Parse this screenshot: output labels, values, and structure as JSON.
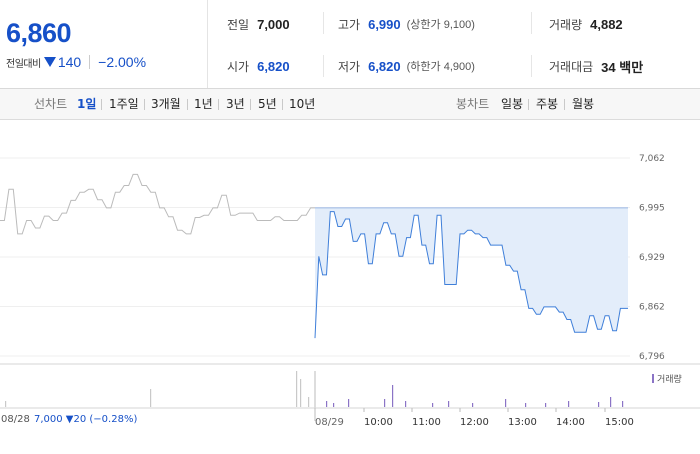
{
  "quote": {
    "price": "6,860",
    "change_label": "전일대비",
    "change_amount": "140",
    "change_percent": "−2.00%",
    "prev_close_label": "전일",
    "prev_close": "7,000",
    "open_label": "시가",
    "open": "6,820",
    "high_label": "고가",
    "high": "6,990",
    "upper_limit": "(상한가 9,100)",
    "low_label": "저가",
    "low": "6,820",
    "lower_limit": "(하한가 4,900)",
    "volume_label": "거래량",
    "volume": "4,882",
    "amount_label": "거래대금",
    "amount": "34 백만",
    "colors": {
      "down": "#1650c8"
    }
  },
  "tabs": {
    "line_label": "선차트",
    "line_items": [
      "1일",
      "1주일",
      "3개월",
      "1년",
      "3년",
      "5년",
      "10년"
    ],
    "candle_label": "봉차트",
    "candle_items": [
      "일봉",
      "주봉",
      "월봉"
    ],
    "active": "1일"
  },
  "chart_data": {
    "type": "line",
    "y_ticks": [
      "7,062",
      "6,995",
      "6,929",
      "6,862",
      "6,796"
    ],
    "ylim": [
      6796,
      7062
    ],
    "x_labels": [
      "08/29",
      "10:00",
      "11:00",
      "12:00",
      "13:00",
      "14:00",
      "15:00"
    ],
    "volume_legend": "거래량",
    "prev_day_date": "08/28",
    "prev_day_info": "7,000 ▼20 (−0.28%)",
    "series": [
      {
        "values": [
          6978,
          6978,
          7020,
          7020,
          6960,
          6960,
          6978,
          6978,
          6968,
          6968,
          6984,
          6984,
          6978,
          6978,
          6988,
          6988,
          7005,
          7005,
          7016,
          7016,
          7020,
          7020,
          7006,
          7006,
          6995,
          6995,
          7016,
          7016,
          7025,
          7025,
          7040,
          7040,
          7025,
          7025,
          7016,
          7016,
          6995,
          6995,
          6983,
          6983,
          6965,
          6965,
          6960,
          6960,
          6982,
          6982,
          6985,
          6985,
          6995,
          6995,
          7012,
          7012,
          6985,
          6985,
          6988,
          6988,
          6988,
          6988,
          6978,
          6978,
          6978,
          6978,
          6983,
          6983,
          6978,
          6978,
          6978,
          6978,
          6985,
          6985,
          6995,
          6995
        ]
      },
      {
        "values": [
          6820,
          6930,
          6905,
          6905,
          6990,
          6990,
          6970,
          6970,
          6980,
          6980,
          6950,
          6950,
          6960,
          6960,
          6920,
          6920,
          6960,
          6960,
          6975,
          6975,
          6960,
          6960,
          6930,
          6930,
          6955,
          6955,
          6985,
          6985,
          6945,
          6945,
          6920,
          6920,
          6985,
          6985,
          6892,
          6892,
          6892,
          6892,
          6960,
          6960,
          6965,
          6965,
          6960,
          6960,
          6955,
          6955,
          6945,
          6945,
          6945,
          6945,
          6918,
          6918,
          6910,
          6910,
          6885,
          6885,
          6860,
          6860,
          6852,
          6852,
          6862,
          6862,
          6862,
          6862,
          6855,
          6855,
          6845,
          6845,
          6828,
          6828,
          6828,
          6828,
          6850,
          6850,
          6832,
          6832,
          6850,
          6850,
          6830,
          6830,
          6860,
          6860,
          6860
        ]
      }
    ]
  }
}
